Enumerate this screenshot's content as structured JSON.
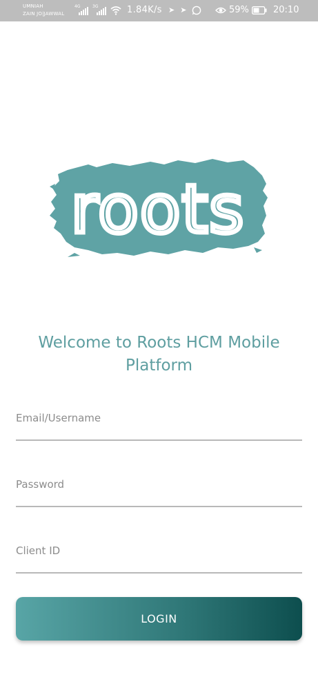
{
  "status_bar": {
    "carrier_line1": "UMNIAH",
    "carrier_line2": "ZAIN JO|JAWWAL",
    "sim1_tag": "4G",
    "sim2_tag": "3G",
    "net_speed": "1.84K/s",
    "battery_percent": "59%",
    "time": "20:10",
    "icons": [
      "signal-icon",
      "signal-icon",
      "wifi-icon",
      "notification-icon",
      "notification-icon",
      "whatsapp-icon",
      "eye-icon",
      "battery-icon"
    ]
  },
  "logo": {
    "text": "roots",
    "color": "#5fa3a5"
  },
  "welcome_text": "Welcome to Roots HCM Mobile Platform",
  "form": {
    "email_placeholder": "Email/Username",
    "email_value": "",
    "password_placeholder": "Password",
    "password_value": "",
    "client_id_placeholder": "Client ID",
    "client_id_value": ""
  },
  "login_button_label": "LOGIN",
  "colors": {
    "accent": "#5e9ea0",
    "button_start": "#58a5a6",
    "button_end": "#0d4e4e"
  }
}
